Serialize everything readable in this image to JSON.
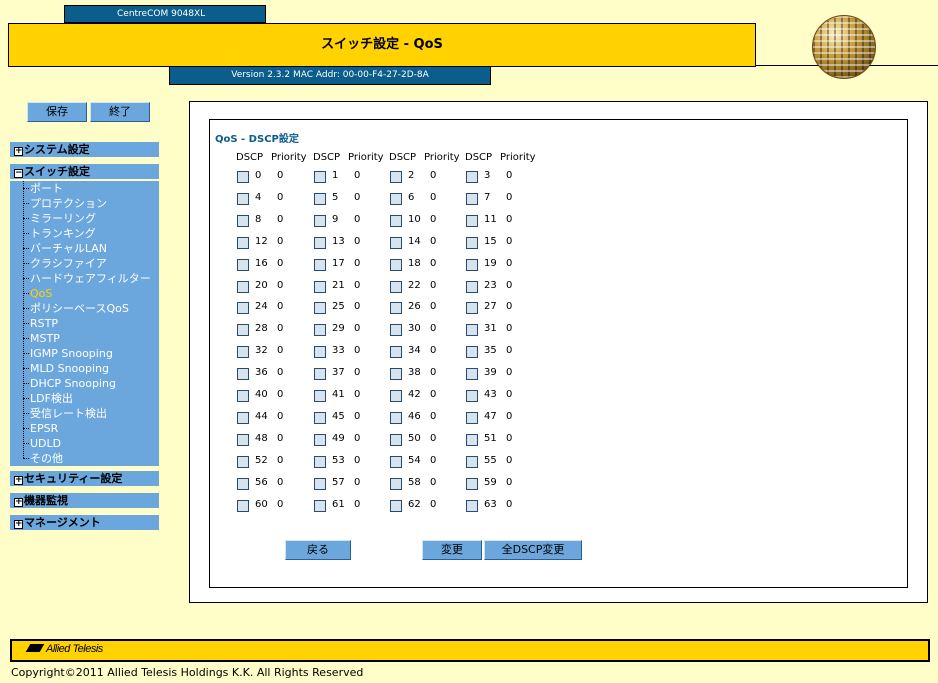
{
  "header": {
    "model": "CentreCOM 9048XL",
    "title": "スイッチ設定 - QoS",
    "version": "Version 2.3.2 MAC Addr: 00-00-F4-27-2D-8A"
  },
  "buttons": {
    "save": "保存",
    "exit": "終了"
  },
  "nav": {
    "system": "システム設定",
    "switch": "スイッチ設定",
    "switch_items": [
      "ポート",
      "プロテクション",
      "ミラーリング",
      "トランキング",
      "バーチャルLAN",
      "クラシファイア",
      "ハードウェアフィルター",
      "QoS",
      "ポリシーベースQoS",
      "RSTP",
      "MSTP",
      "IGMP Snooping",
      "MLD Snooping",
      "DHCP Snooping",
      "LDF検出",
      "受信レート検出",
      "EPSR",
      "UDLD",
      "その他"
    ],
    "active_item": "QoS",
    "security": "セキュリティー設定",
    "monitor": "機器監視",
    "management": "マネージメント"
  },
  "panel": {
    "title": "QoS - DSCP設定",
    "col_dscp": "DSCP",
    "col_priority": "Priority",
    "entries": [
      [
        "0",
        "0"
      ],
      [
        "1",
        "0"
      ],
      [
        "2",
        "0"
      ],
      [
        "3",
        "0"
      ],
      [
        "4",
        "0"
      ],
      [
        "5",
        "0"
      ],
      [
        "6",
        "0"
      ],
      [
        "7",
        "0"
      ],
      [
        "8",
        "0"
      ],
      [
        "9",
        "0"
      ],
      [
        "10",
        "0"
      ],
      [
        "11",
        "0"
      ],
      [
        "12",
        "0"
      ],
      [
        "13",
        "0"
      ],
      [
        "14",
        "0"
      ],
      [
        "15",
        "0"
      ],
      [
        "16",
        "0"
      ],
      [
        "17",
        "0"
      ],
      [
        "18",
        "0"
      ],
      [
        "19",
        "0"
      ],
      [
        "20",
        "0"
      ],
      [
        "21",
        "0"
      ],
      [
        "22",
        "0"
      ],
      [
        "23",
        "0"
      ],
      [
        "24",
        "0"
      ],
      [
        "25",
        "0"
      ],
      [
        "26",
        "0"
      ],
      [
        "27",
        "0"
      ],
      [
        "28",
        "0"
      ],
      [
        "29",
        "0"
      ],
      [
        "30",
        "0"
      ],
      [
        "31",
        "0"
      ],
      [
        "32",
        "0"
      ],
      [
        "33",
        "0"
      ],
      [
        "34",
        "0"
      ],
      [
        "35",
        "0"
      ],
      [
        "36",
        "0"
      ],
      [
        "37",
        "0"
      ],
      [
        "38",
        "0"
      ],
      [
        "39",
        "0"
      ],
      [
        "40",
        "0"
      ],
      [
        "41",
        "0"
      ],
      [
        "42",
        "0"
      ],
      [
        "43",
        "0"
      ],
      [
        "44",
        "0"
      ],
      [
        "45",
        "0"
      ],
      [
        "46",
        "0"
      ],
      [
        "47",
        "0"
      ],
      [
        "48",
        "0"
      ],
      [
        "49",
        "0"
      ],
      [
        "50",
        "0"
      ],
      [
        "51",
        "0"
      ],
      [
        "52",
        "0"
      ],
      [
        "53",
        "0"
      ],
      [
        "54",
        "0"
      ],
      [
        "55",
        "0"
      ],
      [
        "56",
        "0"
      ],
      [
        "57",
        "0"
      ],
      [
        "58",
        "0"
      ],
      [
        "59",
        "0"
      ],
      [
        "60",
        "0"
      ],
      [
        "61",
        "0"
      ],
      [
        "62",
        "0"
      ],
      [
        "63",
        "0"
      ]
    ],
    "back_button": "戻る",
    "change_button": "変更",
    "change_all_button": "全DSCP変更"
  },
  "footer": {
    "logo": "Allied Telesis",
    "copyright": "Copyright©2011 Allied Telesis Holdings K.K. All Rights Reserved"
  },
  "colors": {
    "accent_yellow": "#ffd200",
    "nav_blue": "#6ba7dc",
    "header_blue": "#0b5d8c",
    "background": "#fffdc8"
  }
}
